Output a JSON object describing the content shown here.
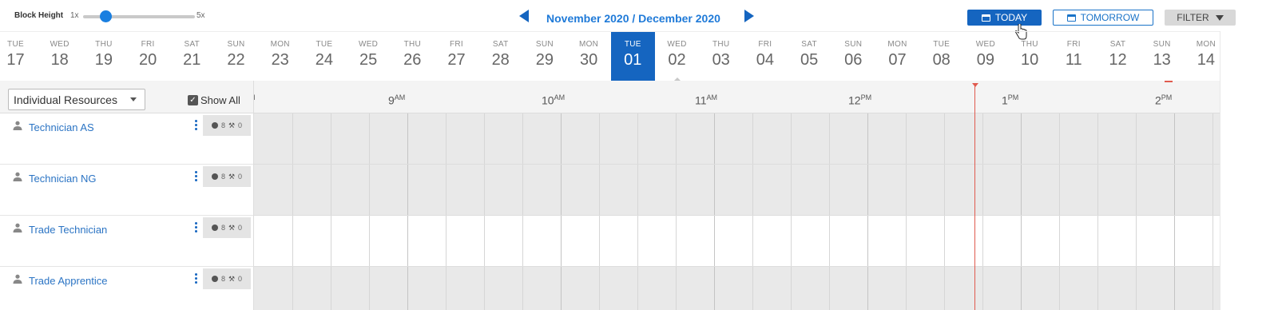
{
  "toolbar": {
    "block_height_label": "Block Height",
    "block_height_min": "1x",
    "block_height_max": "5x",
    "block_height_level": 0.2,
    "period_title": "November 2020 / December 2020",
    "today_label": "TODAY",
    "tomorrow_label": "TOMORROW",
    "filter_label": "FILTER"
  },
  "dates": [
    {
      "dow": "TUE",
      "day": "17"
    },
    {
      "dow": "WED",
      "day": "18"
    },
    {
      "dow": "THU",
      "day": "19"
    },
    {
      "dow": "FRI",
      "day": "20"
    },
    {
      "dow": "SAT",
      "day": "21"
    },
    {
      "dow": "SUN",
      "day": "22"
    },
    {
      "dow": "MON",
      "day": "23"
    },
    {
      "dow": "TUE",
      "day": "24"
    },
    {
      "dow": "WED",
      "day": "25"
    },
    {
      "dow": "THU",
      "day": "26"
    },
    {
      "dow": "FRI",
      "day": "27"
    },
    {
      "dow": "SAT",
      "day": "28"
    },
    {
      "dow": "SUN",
      "day": "29"
    },
    {
      "dow": "MON",
      "day": "30"
    },
    {
      "dow": "TUE",
      "day": "01"
    },
    {
      "dow": "WED",
      "day": "02"
    },
    {
      "dow": "THU",
      "day": "03"
    },
    {
      "dow": "FRI",
      "day": "04"
    },
    {
      "dow": "SAT",
      "day": "05"
    },
    {
      "dow": "SUN",
      "day": "06"
    },
    {
      "dow": "MON",
      "day": "07"
    },
    {
      "dow": "TUE",
      "day": "08"
    },
    {
      "dow": "WED",
      "day": "09"
    },
    {
      "dow": "THU",
      "day": "10"
    },
    {
      "dow": "FRI",
      "day": "11"
    },
    {
      "dow": "SAT",
      "day": "12"
    },
    {
      "dow": "SUN",
      "day": "13"
    },
    {
      "dow": "MON",
      "day": "14"
    }
  ],
  "selected_date": "01",
  "resource_filter": {
    "selected": "Individual Resources",
    "show_all_label": "Show All",
    "show_all_checked": true
  },
  "hours": [
    {
      "h": "",
      "ap": "AM"
    },
    {
      "h": "9",
      "ap": "AM"
    },
    {
      "h": "10",
      "ap": "AM"
    },
    {
      "h": "11",
      "ap": "AM"
    },
    {
      "h": "12",
      "ap": "PM"
    },
    {
      "h": "1",
      "ap": "PM"
    },
    {
      "h": "2",
      "ap": "PM"
    }
  ],
  "resources": [
    {
      "name": "Technician AS",
      "hours": "8",
      "jobs": "0",
      "shaded": true
    },
    {
      "name": "Technician NG",
      "hours": "8",
      "jobs": "0",
      "shaded": true
    },
    {
      "name": "Trade Technician",
      "hours": "8",
      "jobs": "0",
      "shaded": false
    },
    {
      "name": "Trade Apprentice",
      "hours": "8",
      "jobs": "0",
      "shaded": true
    }
  ],
  "colors": {
    "accent": "#1565c0",
    "link": "#2b74c4",
    "now_line": "#e05a4e"
  }
}
